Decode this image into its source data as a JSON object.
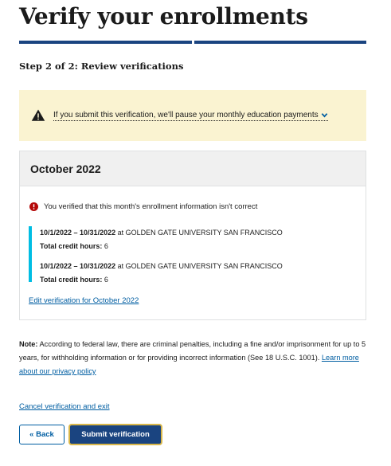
{
  "page": {
    "title": "Verify your enrollments",
    "step_heading": "Step 2 of 2: Review verifications",
    "progress": {
      "current_step": 2,
      "total_steps": 2
    }
  },
  "alert": {
    "text": "If you submit this verification, we'll pause your monthly education payments",
    "icon": "warning-icon",
    "color": "#faf3d1"
  },
  "card": {
    "title": "October 2022",
    "error_text": "You verified that this month's enrollment information isn't correct",
    "error_icon_color": "#b50909",
    "accent_color": "#00bde3",
    "enrollments": [
      {
        "dates": "10/1/2022 – 10/31/2022",
        "connector": " at ",
        "school": "GOLDEN GATE UNIVERSITY SAN FRANCISCO",
        "hours_label": "Total credit hours:",
        "hours_value": " 6"
      },
      {
        "dates": "10/1/2022 – 10/31/2022",
        "connector": " at ",
        "school": "GOLDEN GATE UNIVERSITY SAN FRANCISCO",
        "hours_label": "Total credit hours:",
        "hours_value": " 6"
      }
    ],
    "edit_link": "Edit verification for October 2022"
  },
  "note": {
    "label": "Note:",
    "text": " According to federal law, there are criminal penalties, including a fine and/or imprisonment for up to 5 years, for withholding information or for providing incorrect information (See 18 U.S.C. 1001). ",
    "link": "Learn more about our privacy policy"
  },
  "actions": {
    "cancel_link": "Cancel verification and exit",
    "back_label": "« Back",
    "submit_label": "Submit verification"
  },
  "colors": {
    "primary": "#005ea2",
    "primary_dark": "#1a4480",
    "focus_outline": "#d9b74a"
  }
}
